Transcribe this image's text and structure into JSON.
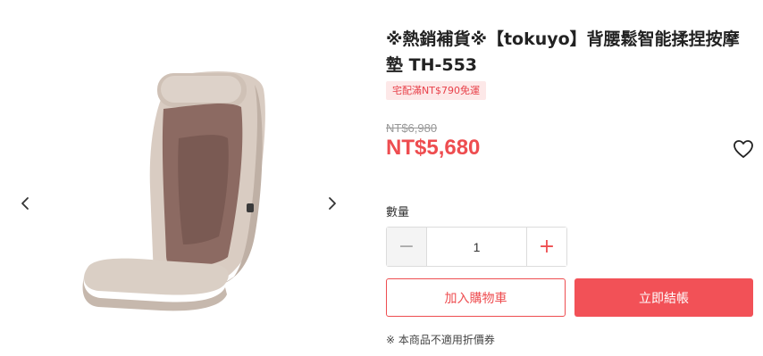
{
  "product": {
    "title": "※熱銷補貨※【tokuyo】背腰鬆智能揉捏按摩墊 TH-553",
    "promo_badge": "宅配滿NT$790免運",
    "original_price": "NT$6,980",
    "sale_price": "NT$5,680"
  },
  "quantity": {
    "label": "數量",
    "value": "1",
    "minus": "−",
    "plus": "+"
  },
  "actions": {
    "add_to_cart": "加入購物車",
    "buy_now": "立即結帳"
  },
  "notice": "※ 本商品不適用折價券",
  "icons": {
    "prev": "chevron-left-icon",
    "next": "chevron-right-icon",
    "wishlist": "heart-icon"
  },
  "colors": {
    "accent": "#ee4d50",
    "buy_button": "#f25157",
    "badge_bg": "#fde8e8"
  }
}
